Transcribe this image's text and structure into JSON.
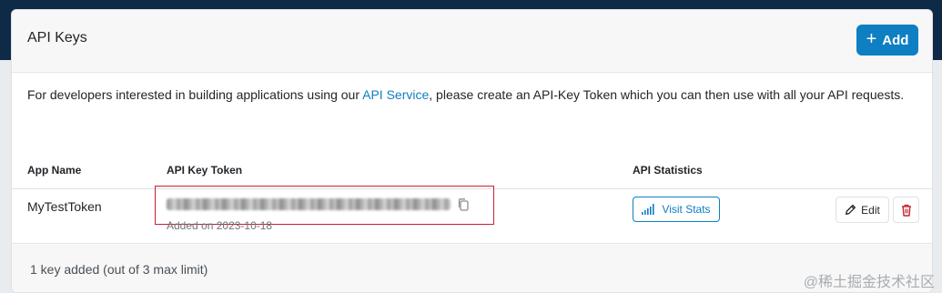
{
  "header": {
    "title": "API Keys",
    "add_label": "Add"
  },
  "description": {
    "before_link": "For developers interested in building applications using our ",
    "link_text": "API Service",
    "after_link": ", please create an API-Key Token which you can then use with all your API requests."
  },
  "table": {
    "columns": [
      "App Name",
      "API Key Token",
      "API Statistics"
    ],
    "rows": [
      {
        "app_name": "MyTestToken",
        "added_on": "Added on 2023-10-18",
        "stats_label": "Visit Stats",
        "edit_label": "Edit"
      }
    ]
  },
  "footer": {
    "summary": "1 key added (out of 3 max limit)"
  },
  "watermark": "@稀土掘金技术社区",
  "icons": {
    "add": "plus-icon",
    "copy": "copy-icon",
    "stats": "signal-bars-icon",
    "edit": "pencil-icon",
    "delete": "trash-icon"
  },
  "colors": {
    "accent": "#0d7fc2",
    "danger": "#c8202f",
    "header_band": "#0f2a47"
  }
}
